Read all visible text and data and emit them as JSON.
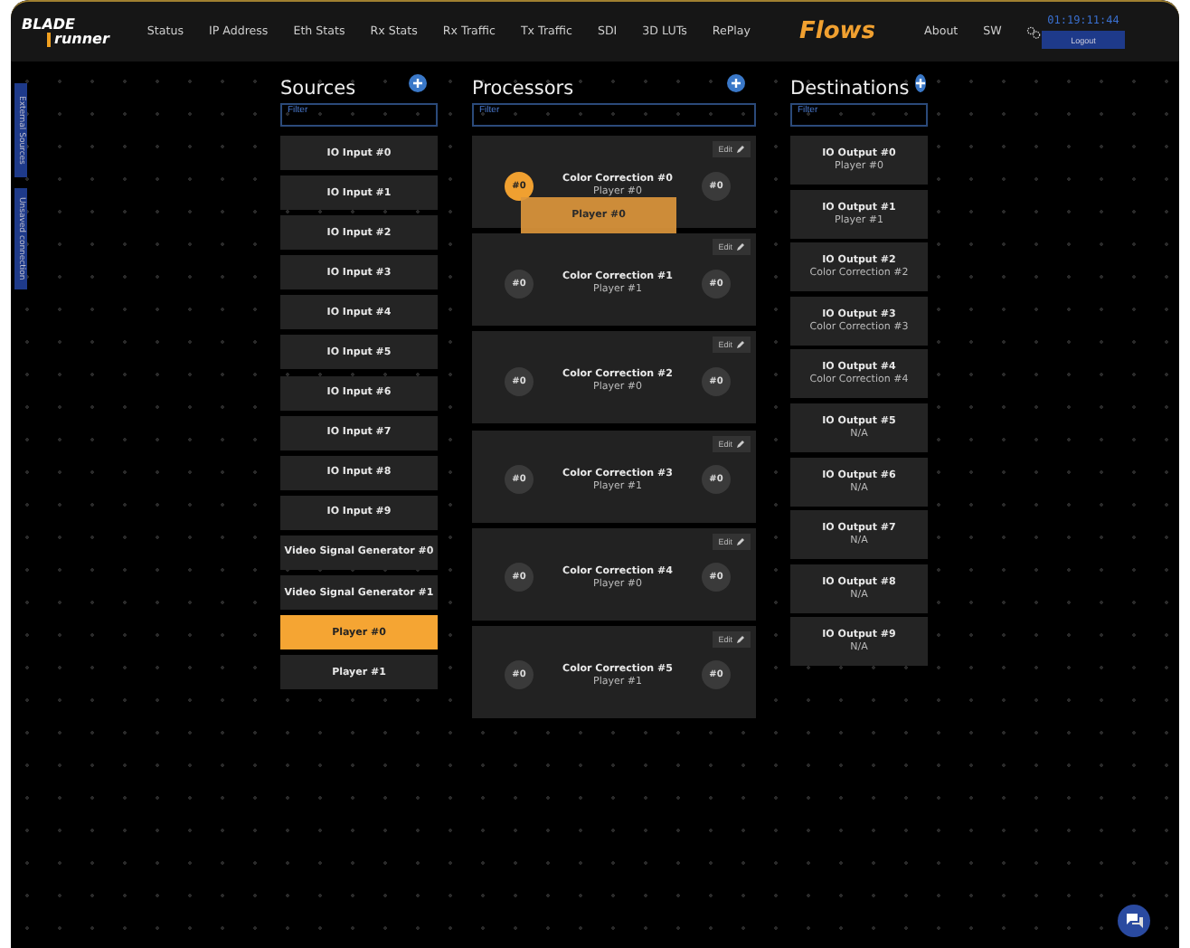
{
  "nav": {
    "logo_top": "BLADE",
    "logo_bottom": "runner",
    "items": [
      {
        "label": "Status",
        "selected": false
      },
      {
        "label": "IP Address",
        "selected": false
      },
      {
        "label": "Eth Stats",
        "selected": false
      },
      {
        "label": "Rx Stats",
        "selected": false
      },
      {
        "label": "Rx Traffic",
        "selected": false
      },
      {
        "label": "Tx Traffic",
        "selected": false
      },
      {
        "label": "SDI",
        "selected": false
      },
      {
        "label": "3D LUTs",
        "selected": false
      },
      {
        "label": "RePlay",
        "selected": false
      },
      {
        "label": "Flows",
        "selected": true
      },
      {
        "label": "About",
        "selected": false
      },
      {
        "label": "SW",
        "selected": false
      }
    ],
    "clock": "01:19:11:44",
    "logout": "Logout"
  },
  "side_tabs": [
    "External Sources",
    "Unsaved connection"
  ],
  "sources": {
    "title": "Sources",
    "filter_placeholder": "Filter",
    "items": [
      {
        "label": "IO Input #0",
        "selected": false
      },
      {
        "label": "IO Input #1",
        "selected": false
      },
      {
        "label": "IO Input #2",
        "selected": false
      },
      {
        "label": "IO Input #3",
        "selected": false
      },
      {
        "label": "IO Input #4",
        "selected": false
      },
      {
        "label": "IO Input #5",
        "selected": false
      },
      {
        "label": "IO Input #6",
        "selected": false
      },
      {
        "label": "IO Input #7",
        "selected": false
      },
      {
        "label": "IO Input #8",
        "selected": false
      },
      {
        "label": "IO Input #9",
        "selected": false
      },
      {
        "label": "Video Signal Generator #0",
        "selected": false
      },
      {
        "label": "Video Signal Generator #1",
        "selected": false
      },
      {
        "label": "Player #0",
        "selected": true
      },
      {
        "label": "Player #1",
        "selected": false
      }
    ]
  },
  "processors": {
    "title": "Processors",
    "filter_placeholder": "Filter",
    "items": [
      {
        "edit_label": "Edit",
        "name": "Color Correction #0",
        "source": "Player #0",
        "input": "#0",
        "output": "#0",
        "input_highlighted": true,
        "drag_label": "Player #0"
      },
      {
        "edit_label": "Edit",
        "name": "Color Correction #1",
        "source": "Player #1",
        "input": "#0",
        "output": "#0",
        "input_highlighted": false
      },
      {
        "edit_label": "Edit",
        "name": "Color Correction #2",
        "source": "Player #0",
        "input": "#0",
        "output": "#0",
        "input_highlighted": false
      },
      {
        "edit_label": "Edit",
        "name": "Color Correction #3",
        "source": "Player #1",
        "input": "#0",
        "output": "#0",
        "input_highlighted": false
      },
      {
        "edit_label": "Edit",
        "name": "Color Correction #4",
        "source": "Player #0",
        "input": "#0",
        "output": "#0",
        "input_highlighted": false
      },
      {
        "edit_label": "Edit",
        "name": "Color Correction #5",
        "source": "Player #1",
        "input": "#0",
        "output": "#0",
        "input_highlighted": false
      }
    ]
  },
  "destinations": {
    "title": "Destinations",
    "filter_placeholder": "Filter",
    "items": [
      {
        "name": "IO Output #0",
        "source": "Player #0"
      },
      {
        "name": "IO Output #1",
        "source": "Player #1"
      },
      {
        "name": "IO Output #2",
        "source": "Color Correction #2"
      },
      {
        "name": "IO Output #3",
        "source": "Color Correction #3"
      },
      {
        "name": "IO Output #4",
        "source": "Color Correction #4"
      },
      {
        "name": "IO Output #5",
        "source": "N/A"
      },
      {
        "name": "IO Output #6",
        "source": "N/A"
      },
      {
        "name": "IO Output #7",
        "source": "N/A"
      },
      {
        "name": "IO Output #8",
        "source": "N/A"
      },
      {
        "name": "IO Output #9",
        "source": "N/A"
      }
    ]
  }
}
